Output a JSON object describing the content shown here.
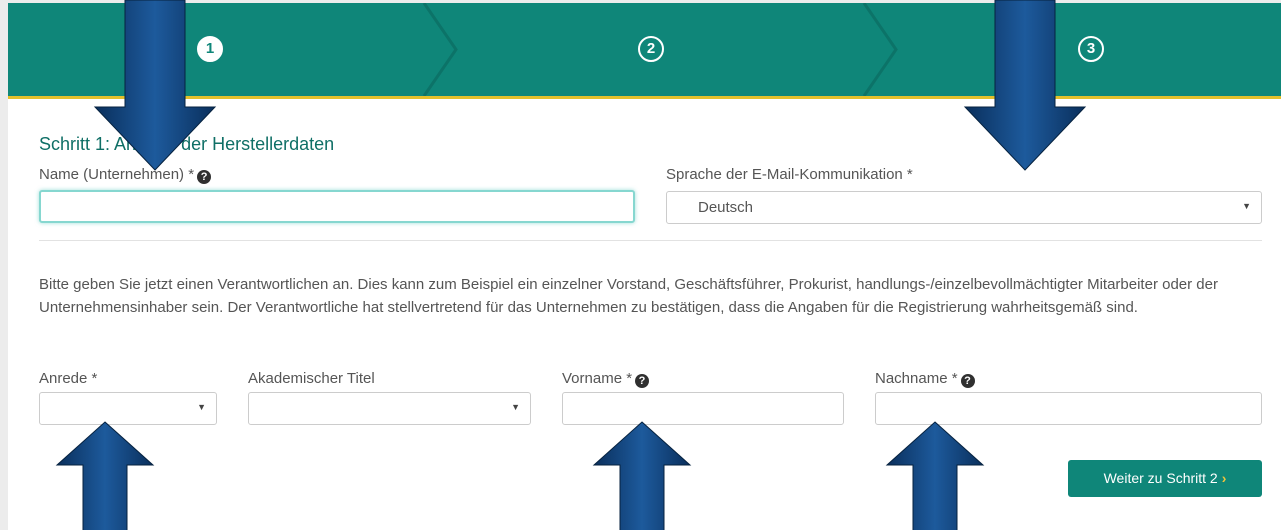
{
  "steps": [
    {
      "number": "1",
      "state": "active"
    },
    {
      "number": "2",
      "state": "inactive"
    },
    {
      "number": "3",
      "state": "inactive"
    }
  ],
  "heading": "Schritt 1: Angabe der Herstellerdaten",
  "form": {
    "company_name": {
      "label": "Name (Unternehmen) *",
      "value": "",
      "help_icon": "question-circle-icon"
    },
    "email_language": {
      "label": "Sprache der E-Mail-Kommunikation *",
      "value": "Deutsch"
    },
    "info_text": "Bitte geben Sie jetzt einen Verantwortlichen an. Dies kann zum Beispiel ein einzelner Vorstand, Geschäftsführer, Prokurist, handlungs-/einzelbevollmächtigter Mitarbeiter oder der Unternehmensinhaber sein. Der Verantwortliche hat stellvertretend für das Unternehmen zu bestätigen, dass die Angaben für die Registrierung wahrheitsgemäß sind.",
    "salutation": {
      "label": "Anrede *",
      "value": ""
    },
    "academic_title": {
      "label": "Akademischer Titel",
      "value": ""
    },
    "first_name": {
      "label": "Vorname *",
      "value": ""
    },
    "last_name": {
      "label": "Nachname *",
      "value": ""
    }
  },
  "next_button": {
    "label": "Weiter zu Schritt 2",
    "icon": "chevron-right-icon"
  },
  "colors": {
    "primary": "#0f8679",
    "accent": "#e3c02c",
    "arrow": "#0b3a6e",
    "heading": "#0f6f66"
  }
}
